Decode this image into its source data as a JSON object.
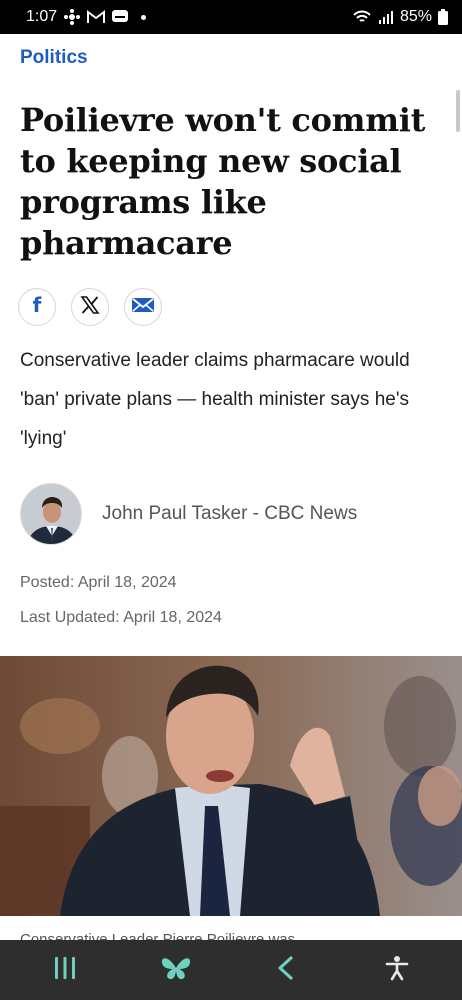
{
  "status_bar": {
    "time": "1:07",
    "left_icons": [
      "cbc-gem-icon",
      "gmail-icon",
      "message-icon"
    ],
    "battery_percent": "85%"
  },
  "article": {
    "section": "Politics",
    "headline": "Poilievre won't commit to keeping new social programs like pharmacare",
    "deck": "Conservative leader claims pharmacare would 'ban' private plans — health minister says he's 'lying'",
    "author": "John Paul Tasker - CBC News",
    "posted": "Posted: April 18, 2024",
    "updated": "Last Updated: April 18, 2024",
    "caption": "Conservative Leader Pierre Poilievre was"
  },
  "share_buttons": [
    "facebook-icon",
    "x-icon",
    "email-icon"
  ],
  "nav_bar": [
    "recent-apps-icon",
    "butterfly-icon",
    "back-icon",
    "accessibility-icon"
  ],
  "colors": {
    "accent": "#1d5cc5",
    "nav_icons": "#6fd0bd",
    "nav_bg": "#2e2e2e"
  }
}
